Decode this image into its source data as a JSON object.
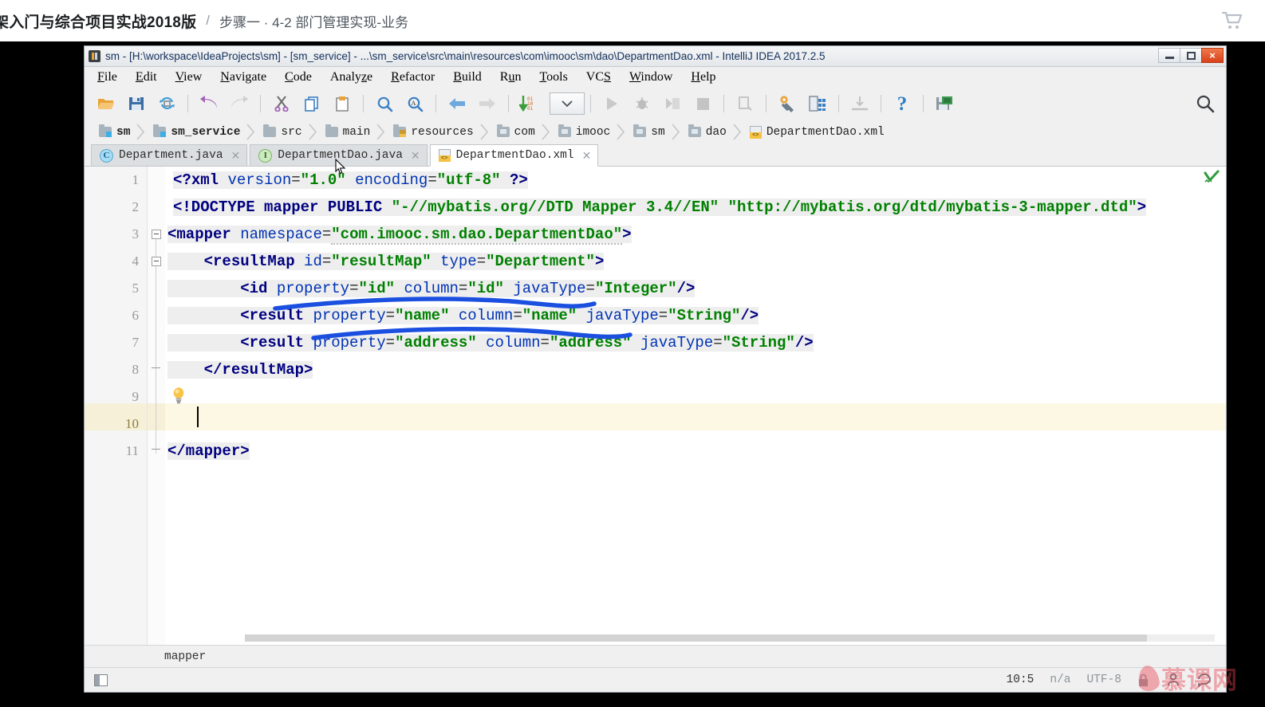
{
  "course": {
    "title": "架入门与综合项目实战2018版",
    "separator": "/",
    "step": "步骤一 · 4-2 部门管理实现-业务",
    "cart_icon": "shopping-cart-icon"
  },
  "ide": {
    "title": "sm - [H:\\workspace\\IdeaProjects\\sm] - [sm_service] - ...\\sm_service\\src\\main\\resources\\com\\imooc\\sm\\dao\\DepartmentDao.xml - IntelliJ IDEA 2017.2.5",
    "app_icon": "intellij-idea-icon",
    "window_controls": {
      "minimize": "minimize-icon",
      "maximize": "restore-icon",
      "close": "×"
    },
    "menu": [
      {
        "label": "File",
        "mnemonic": "F"
      },
      {
        "label": "Edit",
        "mnemonic": "E"
      },
      {
        "label": "View",
        "mnemonic": "V"
      },
      {
        "label": "Navigate",
        "mnemonic": "N"
      },
      {
        "label": "Code",
        "mnemonic": "C"
      },
      {
        "label": "Analyze",
        "mnemonic": "z"
      },
      {
        "label": "Refactor",
        "mnemonic": "R"
      },
      {
        "label": "Build",
        "mnemonic": "B"
      },
      {
        "label": "Run",
        "mnemonic": "u"
      },
      {
        "label": "Tools",
        "mnemonic": "T"
      },
      {
        "label": "VCS",
        "mnemonic": "S"
      },
      {
        "label": "Window",
        "mnemonic": "W"
      },
      {
        "label": "Help",
        "mnemonic": "H"
      }
    ],
    "toolbar": [
      "open-folder-icon",
      "save-all-icon",
      "sync-refresh-icon",
      "sep",
      "undo-icon",
      "redo-icon",
      "sep",
      "cut-icon",
      "copy-icon",
      "paste-icon",
      "sep",
      "find-icon",
      "replace-icon",
      "sep",
      "back-navigate-icon",
      "forward-navigate-icon",
      "sep",
      "compile-icon",
      "run-config-dropdown-icon",
      "sep",
      "run-icon",
      "debug-icon",
      "coverage-icon",
      "stop-icon",
      "sep",
      "update-project-icon",
      "sep",
      "settings-gear-icon",
      "project-structure-icon",
      "sep",
      "commit-icon",
      "sep",
      "help-icon",
      "sep",
      "save-database-icon"
    ],
    "toolbar_search_icon": "search-everywhere-icon",
    "breadcrumb": [
      {
        "label": "sm",
        "icon": "module-folder-icon",
        "bold": true
      },
      {
        "label": "sm_service",
        "icon": "module-folder-icon",
        "bold": true
      },
      {
        "label": "src",
        "icon": "folder-icon",
        "bold": false
      },
      {
        "label": "main",
        "icon": "folder-icon",
        "bold": false
      },
      {
        "label": "resources",
        "icon": "resources-folder-icon",
        "bold": false
      },
      {
        "label": "com",
        "icon": "package-folder-icon",
        "bold": false
      },
      {
        "label": "imooc",
        "icon": "package-folder-icon",
        "bold": false
      },
      {
        "label": "sm",
        "icon": "package-folder-icon",
        "bold": false
      },
      {
        "label": "dao",
        "icon": "package-folder-icon",
        "bold": false
      },
      {
        "label": "DepartmentDao.xml",
        "icon": "xml-file-icon",
        "bold": false
      }
    ],
    "tabs": [
      {
        "label": "Department.java",
        "icon": "java-class-icon",
        "glyph": "C",
        "active": false
      },
      {
        "label": "DepartmentDao.java",
        "icon": "java-interface-icon",
        "glyph": "I",
        "active": false
      },
      {
        "label": "DepartmentDao.xml",
        "icon": "xml-file-icon",
        "glyph": "",
        "active": true
      }
    ],
    "tab_close_glyph": "✕",
    "editor": {
      "caret_line": 10,
      "line_numbers": [
        "1",
        "2",
        "3",
        "4",
        "5",
        "6",
        "7",
        "8",
        "9",
        "10",
        "11"
      ],
      "lines": [
        {
          "n": 1,
          "indent": 0,
          "text": "<?xml version=\"1.0\" encoding=\"utf-8\" ?>"
        },
        {
          "n": 2,
          "indent": 0,
          "text": "<!DOCTYPE mapper PUBLIC \"-//mybatis.org//DTD Mapper 3.4//EN\" \"http://mybatis.org/dtd/mybatis-3-mapper.dtd\">"
        },
        {
          "n": 3,
          "indent": 0,
          "text": "<mapper namespace=\"com.imooc.sm.dao.DepartmentDao\">"
        },
        {
          "n": 4,
          "indent": 1,
          "text": "<resultMap id=\"resultMap\" type=\"Department\">"
        },
        {
          "n": 5,
          "indent": 2,
          "text": "<id property=\"id\" column=\"id\" javaType=\"Integer\"/>"
        },
        {
          "n": 6,
          "indent": 2,
          "text": "<result property=\"name\" column=\"name\" javaType=\"String\"/>"
        },
        {
          "n": 7,
          "indent": 2,
          "text": "<result property=\"address\" column=\"address\" javaType=\"String\"/>"
        },
        {
          "n": 8,
          "indent": 1,
          "text": "</resultMap>"
        },
        {
          "n": 9,
          "indent": 0,
          "text": ""
        },
        {
          "n": 10,
          "indent": 0,
          "text": ""
        },
        {
          "n": 11,
          "indent": 0,
          "text": "</mapper>"
        }
      ],
      "intention_bulb_icon": "lightbulb-icon",
      "inspection_ok_icon": "inspection-ok-checkmark-icon"
    },
    "bottom_breadcrumb": "mapper",
    "status_bar": {
      "toggle_icon": "toggle-toolwindows-icon",
      "caret_position": "10:5",
      "line_separator": "n/a",
      "encoding": "UTF-8",
      "lock_icon": "write-lock-icon",
      "git_icon": "git-branch-icon",
      "event_log_icon": "event-log-icon"
    }
  },
  "watermark": {
    "flame_icon": "imooc-flame-icon",
    "text": "慕课网"
  },
  "colors": {
    "xml_tag": "#000080",
    "xml_attr": "#0033b3",
    "xml_value": "#008000",
    "annotation_blue": "#1a4fe0",
    "caret_line_bg": "#fdf8e3",
    "brand_red": "#e8414f",
    "close_button": "#d8411a"
  },
  "annotation": {
    "type": "hand-drawn-underline",
    "color": "#1a4fe0",
    "strokes": 2,
    "targets": [
      "line 5 property..javaType",
      "line 6 property..name"
    ]
  }
}
